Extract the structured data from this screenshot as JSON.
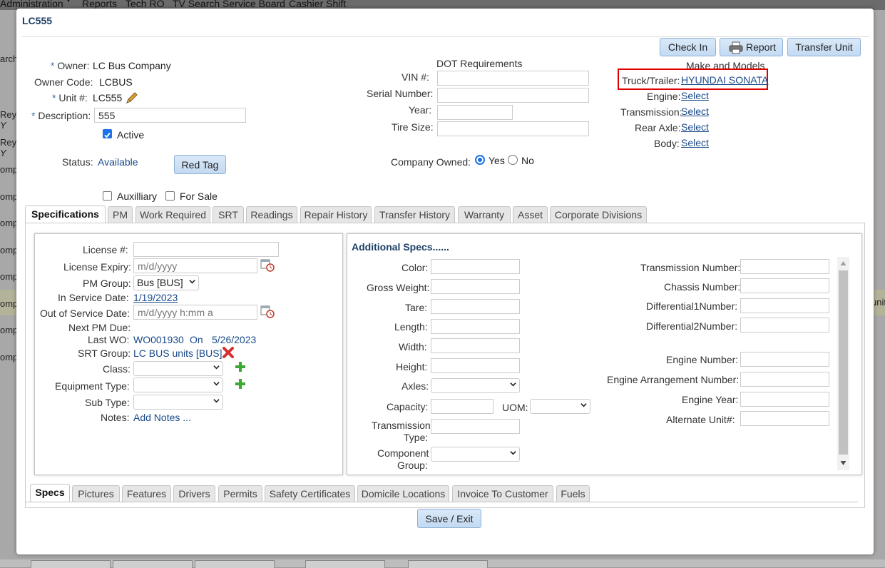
{
  "background": {
    "menu": [
      "Administration",
      "Reports",
      "Tech RO",
      "TV Search Service Board",
      "Cashier Shift"
    ],
    "left_fragments": [
      "arch",
      "Reyr",
      "Y",
      "Reyr",
      "Y",
      "omp",
      "omp",
      "omp",
      "omp",
      "omp",
      "omp",
      "omp",
      "omp"
    ],
    "right_fragment": "unit"
  },
  "modal": {
    "title": "LC555",
    "buttons": {
      "check_in": "Check In",
      "report": "Report",
      "transfer_unit": "Transfer Unit"
    },
    "owner": {
      "label": "Owner:",
      "value": "LC Bus Company"
    },
    "owner_code": {
      "label": "Owner Code:",
      "value": "LCBUS"
    },
    "unit": {
      "label": "Unit #:",
      "value": "LC555"
    },
    "description": {
      "label": "Description:",
      "value": "555"
    },
    "active_label": "Active",
    "status": {
      "label": "Status:",
      "value": "Available"
    },
    "red_tag": "Red Tag",
    "auxilliary_label": "Auxilliary",
    "for_sale_label": "For Sale",
    "dot": {
      "heading": "DOT Requirements",
      "vin_label": "VIN #:",
      "serial_label": "Serial Number:",
      "year_label": "Year:",
      "tire_label": "Tire Size:",
      "company_owned_label": "Company Owned:",
      "yes": "Yes",
      "no": "No"
    },
    "make_models": {
      "heading": "Make and Models",
      "truck_label": "Truck/Trailer:",
      "truck_value": "HYUNDAI SONATA",
      "engine_label": "Engine:",
      "transmission_label": "Transmission:",
      "rear_axle_label": "Rear Axle:",
      "body_label": "Body:",
      "select": "Select"
    },
    "top_tabs": [
      "Specifications",
      "PM",
      "Work Required",
      "SRT",
      "Readings",
      "Repair History",
      "Transfer History",
      "Warranty",
      "Asset",
      "Corporate Divisions"
    ],
    "left_panel": {
      "license_label": "License #:",
      "license_expiry_label": "License Expiry:",
      "license_expiry_placeholder": "m/d/yyyy",
      "pm_group_label": "PM Group:",
      "pm_group_value": "Bus [BUS]",
      "in_service_label": "In Service Date:",
      "in_service_value": "1/19/2023",
      "out_service_label": "Out of Service Date:",
      "out_service_placeholder": "m/d/yyyy h:mm a",
      "next_pm_label": "Next PM Due:",
      "last_wo_label": "Last WO:",
      "last_wo_value": "WO001930",
      "last_wo_on": "On",
      "last_wo_date": "5/26/2023",
      "srt_group_label": "SRT Group:",
      "srt_group_value": "LC BUS units [BUS]",
      "class_label": "Class:",
      "equipment_type_label": "Equipment Type:",
      "sub_type_label": "Sub Type:",
      "notes_label": "Notes:",
      "notes_link": "Add Notes ..."
    },
    "additional": {
      "heading": "Additional Specs......",
      "left_fields": [
        "Color:",
        "Gross Weight:",
        "Tare:",
        "Length:",
        "Width:",
        "Height:",
        "Axles:",
        "Capacity:"
      ],
      "uom_label": "UOM:",
      "transmission_type_label": [
        "Transmission",
        "Type:"
      ],
      "component_group_label": [
        "Component",
        "Group:"
      ],
      "right_fields": [
        "Transmission Number:",
        "Chassis Number:",
        "Differential1Number:",
        "Differential2Number:",
        "Engine Number:",
        "Engine Arrangement Number:",
        "Engine Year:",
        "Alternate Unit#:"
      ]
    },
    "bottom_tabs": [
      "Specs",
      "Pictures",
      "Features",
      "Drivers",
      "Permits",
      "Safety Certificates",
      "Domicile Locations",
      "Invoice To Customer",
      "Fuels"
    ],
    "save_exit": "Save / Exit"
  },
  "colors": {
    "accent": "#1a4a8a",
    "highlight_box": "#e00000",
    "button_bg": "#c3daf2"
  },
  "icons": [
    "pencil-icon",
    "printer-icon",
    "calendar-clock-icon",
    "remove-x-icon",
    "add-plus-icon",
    "chevron-down-icon"
  ]
}
